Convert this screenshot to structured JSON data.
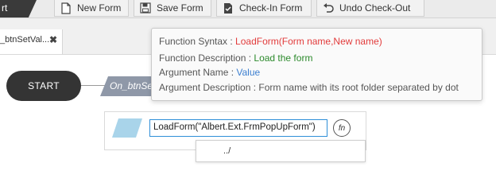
{
  "toolbar": {
    "start_label": "rt",
    "buttons": [
      {
        "label": "New Form",
        "icon": "new-form-icon"
      },
      {
        "label": "Save Form",
        "icon": "save-icon"
      },
      {
        "label": "Check-In Form",
        "icon": "check-in-icon"
      },
      {
        "label": "Undo Check-Out",
        "icon": "undo-icon"
      }
    ]
  },
  "tab": {
    "label": "_btnSetVal...",
    "close": "✖"
  },
  "flow": {
    "start_label": "START",
    "event_label": "On_btnSe",
    "expression": "LoadForm(\"Albert.Ext.FrmPopUpForm\")",
    "fn_button": "fn",
    "suggestion": "../"
  },
  "tooltip": {
    "syntax_label": "Function Syntax : ",
    "syntax_value": "LoadForm(Form name,New name)",
    "description_label": "Function Description : ",
    "description_value": "Load the form",
    "argname_label": "Argument Name : ",
    "argname_value": "Value",
    "argdesc_label": "Argument Description : ",
    "argdesc_value": "Form name with its root folder separated by dot"
  },
  "colors": {
    "syntax": "#e23b3b",
    "description": "#2c8a2c",
    "argument": "#3c7fd0",
    "start_node": "#343434"
  }
}
